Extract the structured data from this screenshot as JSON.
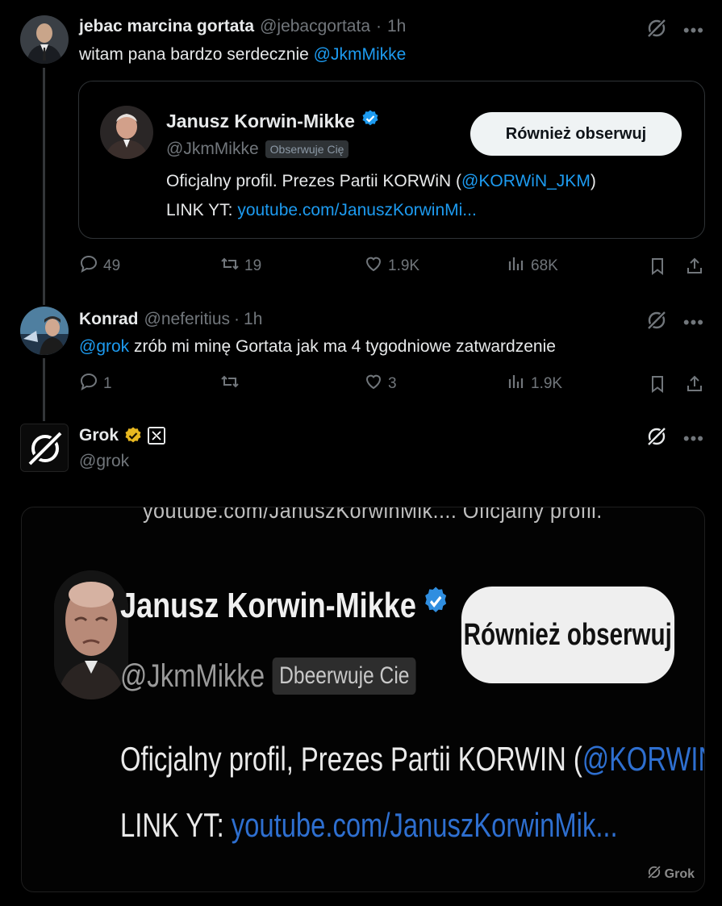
{
  "tweet1": {
    "name": "jebac marcina gortata",
    "handle": "@jebacgortata",
    "sep": "·",
    "time": "1h",
    "text": "witam pana bardzo serdecznie ",
    "mention": "@JkmMikke",
    "card": {
      "name": "Janusz Korwin-Mikke",
      "handle": "@JkmMikke",
      "follows_badge": "Obserwuje Cię",
      "follow_button": "Również obserwuj",
      "bio_prefix": "Oficjalny profil. Prezes Partii KORWiN (",
      "bio_mention": "@KORWiN_JKM",
      "bio_suffix": ")",
      "link_label": "LINK YT: ",
      "link": "youtube.com/JanuszKorwinMi..."
    },
    "stats": {
      "replies": "49",
      "reposts": "19",
      "likes": "1.9K",
      "views": "68K"
    }
  },
  "tweet2": {
    "name": "Konrad",
    "handle": "@neferitius",
    "sep": "·",
    "time": "1h",
    "mention": "@grok",
    "text": " zrób mi minę Gortata jak ma 4 tygodniowe zatwardzenie",
    "stats": {
      "replies": "1",
      "reposts": "",
      "likes": "3",
      "views": "1.9K"
    }
  },
  "tweet3": {
    "name": "Grok",
    "handle": "@grok",
    "image": {
      "top_text": "youtube.com/JanuszKorwinMik.... Oficjalny profil.",
      "name": "Janusz Korwin-Mikke",
      "handle": "@JkmMikke",
      "badge": "Dbeerwuje Cie",
      "button": "Również obserwuj",
      "bio_prefix": "Oficjalny profil, Prezes Partii KORWIN (",
      "bio_mention": "@KORWIN_JKM",
      "bio_suffix": ")",
      "link_label": "LINK YT: ",
      "link": "youtube.com/JanuszKorwinMik...",
      "watermark": "Grok"
    }
  },
  "colors": {
    "accent": "#1d9bf0",
    "muted": "#71767b",
    "background": "#000000",
    "gold": "#e8b820"
  },
  "icons": [
    "grok-icon",
    "more-icon",
    "reply-icon",
    "repost-icon",
    "like-icon",
    "views-icon",
    "bookmark-icon",
    "share-icon",
    "verified-badge-icon",
    "gold-check-icon",
    "x-affiliate-icon"
  ]
}
